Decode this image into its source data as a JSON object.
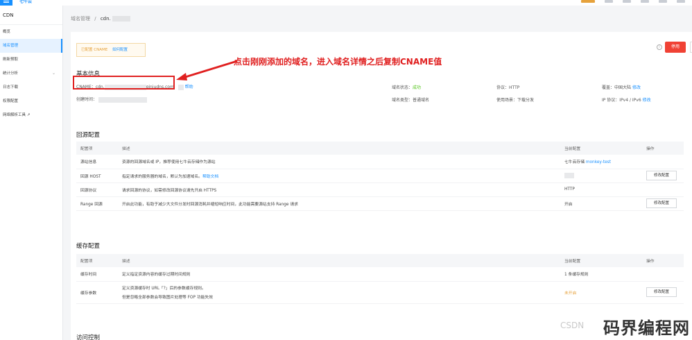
{
  "topbar": {
    "logo": "七牛云"
  },
  "sidebar": {
    "title": "CDN",
    "items": [
      {
        "label": "概览"
      },
      {
        "label": "域名管理"
      },
      {
        "label": "刷新预取"
      },
      {
        "label": "统计分析"
      },
      {
        "label": "日志下载"
      },
      {
        "label": "权限配置"
      },
      {
        "label": "网络解析工具 ↗"
      }
    ]
  },
  "breadcrumb": {
    "root": "域名管理",
    "sep": "/",
    "current": "cdn."
  },
  "actions": {
    "stop": "停用"
  },
  "cname_notice": {
    "text": "已配置 CNAME",
    "link": "如何配置"
  },
  "annotation": "点击刚刚添加的域名，进入域名详情之后复制CNAME值",
  "basic_info": {
    "title": "基本信息",
    "cname_label": "CNAME：cdn.",
    "cname_suffix": "qiniudns.com",
    "help": "帮助",
    "created_label": "创建时间：",
    "status_label": "域名状态：",
    "status_value": "成功",
    "type_label": "域名类型：普通域名",
    "protocol": "协议：HTTP",
    "scene": "使用场景：下载分发",
    "coverage_label": "覆盖：中国大陆",
    "coverage_edit": "修改",
    "ip_label": "IP 协议：IPv4 / IPv6",
    "ip_edit": "修改"
  },
  "origin": {
    "title": "回源配置",
    "headers": [
      "配置项",
      "描述",
      "当前配置",
      "操作"
    ],
    "rows": [
      {
        "name": "源站信息",
        "desc": "资源的回源域名或 IP，推荐使用七牛云存储作为源站",
        "current": "七牛云存储 ",
        "current_link": "monkey-test",
        "action": ""
      },
      {
        "name": "回源 HOST",
        "desc": "指定请求的服务器的域名，默认为加速域名。",
        "desc_link": "帮助文档",
        "current": "",
        "action": "修改配置"
      },
      {
        "name": "回源协议",
        "desc": "请求回源的协议，如需修改回源协议请先开启 HTTPS",
        "current": "HTTP",
        "action": ""
      },
      {
        "name": "Range 回源",
        "desc": "开启此功能，有助于减少大文件分发时回源消耗并缩短响应时间，此功能需要源站支持 Range 请求",
        "current": "开启",
        "action": "修改配置"
      }
    ]
  },
  "cache": {
    "title": "缓存配置",
    "headers": [
      "配置项",
      "描述",
      "当前配置",
      "操作"
    ],
    "rows": [
      {
        "name": "缓存时间",
        "desc": "定义指定资源内容的缓存过期时间规则",
        "current": "1 条缓存规则",
        "action": ""
      },
      {
        "name": "缓存参数",
        "desc": "定义资源缓存时 URL「?」后的参数缓存规则。",
        "desc2": "但是忽略全部参数会导致图片处理等 FOP 功能失效",
        "current": "未开启",
        "action": "修改配置"
      }
    ]
  },
  "access": {
    "title": "访问控制"
  },
  "watermarks": {
    "csdn": "CSDN",
    "site": "码界编程网"
  }
}
